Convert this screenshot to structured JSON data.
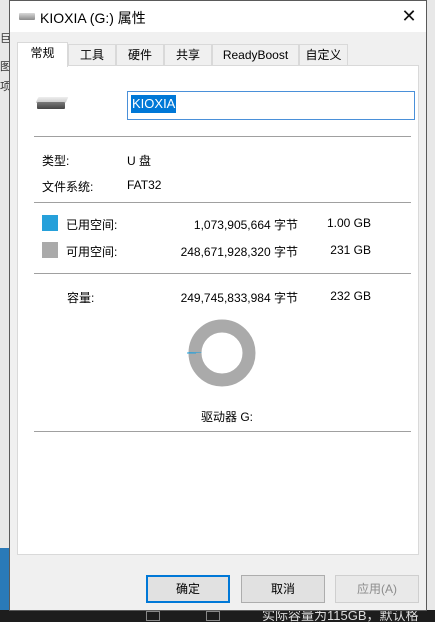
{
  "window": {
    "title": "KIOXIA (G:) 属性",
    "close_glyph": "✕"
  },
  "tabs": [
    {
      "label": "常规",
      "active": true
    },
    {
      "label": "工具"
    },
    {
      "label": "硬件"
    },
    {
      "label": "共享"
    },
    {
      "label": "ReadyBoost"
    },
    {
      "label": "自定义"
    }
  ],
  "general": {
    "drive_name": "KIOXIA",
    "type_label": "类型:",
    "type_value": "U 盘",
    "fs_label": "文件系统:",
    "fs_value": "FAT32",
    "used": {
      "label": "已用空间:",
      "bytes": "1,073,905,664 字节",
      "size": "1.00 GB",
      "color": "#26a0da"
    },
    "free": {
      "label": "可用空间:",
      "bytes": "248,671,928,320 字节",
      "size": "231 GB",
      "color": "#aaaaaa"
    },
    "capacity": {
      "label": "容量:",
      "bytes": "249,745,833,984 字节",
      "size": "232 GB"
    },
    "used_fraction": 0.0043,
    "drive_label": "驱动器 G:"
  },
  "buttons": {
    "ok": "确定",
    "cancel": "取消",
    "apply": "应用(A)"
  },
  "background": {
    "bottom_snippet": "实际容量为115GB，默认格"
  },
  "icons": {
    "title": "usb-drive-icon",
    "drive": "usb-drive-icon",
    "close": "close-icon"
  }
}
